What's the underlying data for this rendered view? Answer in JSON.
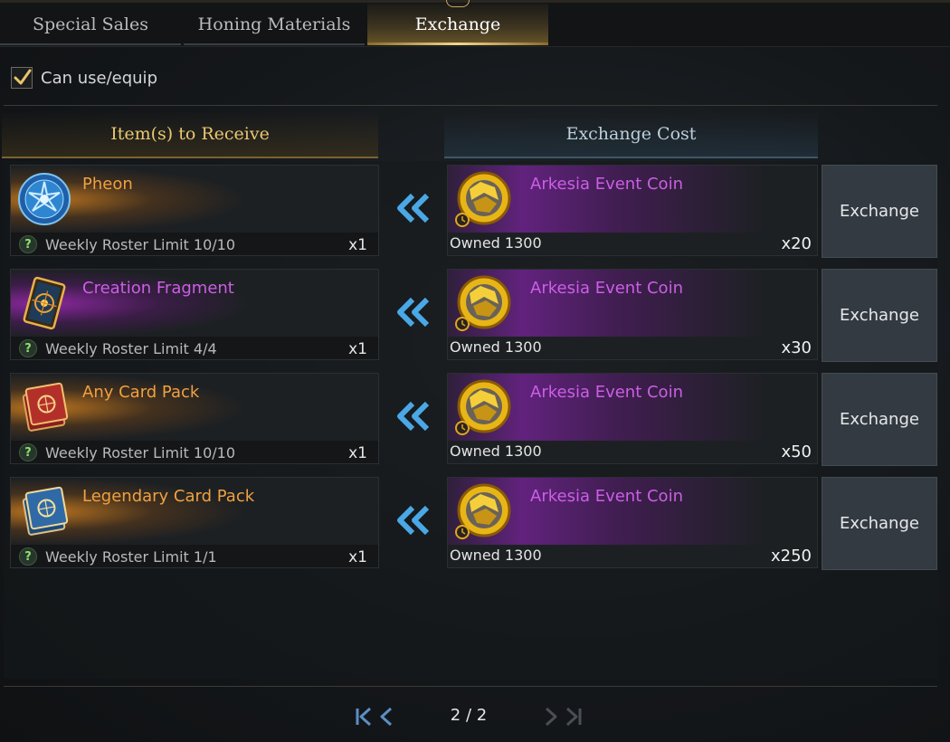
{
  "tabs": [
    {
      "label": "Special Sales",
      "active": false
    },
    {
      "label": "Honing Materials",
      "active": false
    },
    {
      "label": "Exchange",
      "active": true
    }
  ],
  "filter": {
    "label": "Can use/equip",
    "checked": true
  },
  "columns": {
    "receive": "Item(s) to Receive",
    "cost": "Exchange Cost"
  },
  "rows": [
    {
      "item": {
        "name": "Pheon",
        "icon": "pheon-icon",
        "rarity_color": "#f0a140",
        "limit": "Weekly Roster Limit 10/10",
        "qty": "x1"
      },
      "cost": {
        "name": "Arkesia Event Coin",
        "icon": "event-coin-icon",
        "owned": "Owned 1300",
        "qty": "x20"
      },
      "button": "Exchange"
    },
    {
      "item": {
        "name": "Creation Fragment",
        "icon": "creation-fragment-icon",
        "rarity_color": "#cc5ee6",
        "limit": "Weekly Roster Limit 4/4",
        "qty": "x1"
      },
      "cost": {
        "name": "Arkesia Event Coin",
        "icon": "event-coin-icon",
        "owned": "Owned 1300",
        "qty": "x30"
      },
      "button": "Exchange"
    },
    {
      "item": {
        "name": "Any Card Pack",
        "icon": "card-pack-red-icon",
        "rarity_color": "#f0a140",
        "limit": "Weekly Roster Limit 10/10",
        "qty": "x1"
      },
      "cost": {
        "name": "Arkesia Event Coin",
        "icon": "event-coin-icon",
        "owned": "Owned 1300",
        "qty": "x50"
      },
      "button": "Exchange"
    },
    {
      "item": {
        "name": "Legendary Card Pack",
        "icon": "card-pack-blue-icon",
        "rarity_color": "#f0a140",
        "limit": "Weekly Roster Limit 1/1",
        "qty": "x1"
      },
      "cost": {
        "name": "Arkesia Event Coin",
        "icon": "event-coin-icon",
        "owned": "Owned 1300",
        "qty": "x250"
      },
      "button": "Exchange"
    }
  ],
  "pagination": {
    "current": "2 / 2",
    "first_icon": "first-page-icon",
    "prev_icon": "prev-page-icon",
    "next_icon": "next-page-icon",
    "last_icon": "last-page-icon"
  },
  "colors": {
    "accent_gold": "#e9c870",
    "legendary_orange": "#f0a140",
    "epic_purple": "#cc5ee6",
    "arrow_blue": "#4aa8e6"
  }
}
